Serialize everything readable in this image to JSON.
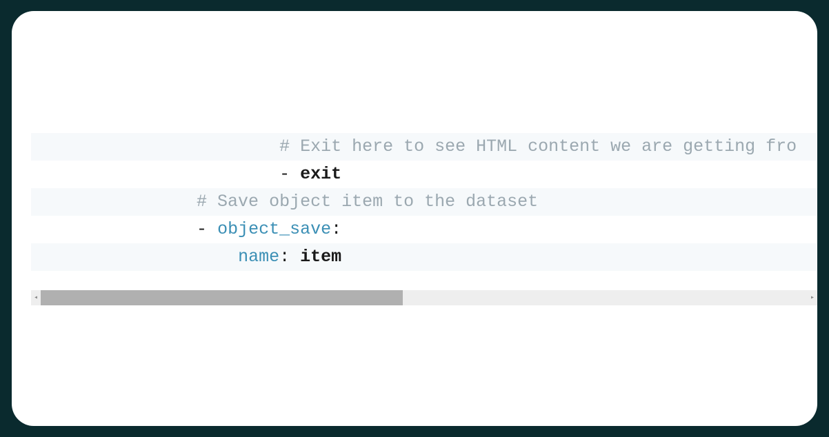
{
  "code": {
    "lines": [
      {
        "indent": "                        ",
        "segments": [
          {
            "type": "comment",
            "text": "# Exit here to see HTML content we are getting fro"
          }
        ],
        "striped": true
      },
      {
        "indent": "                        ",
        "segments": [
          {
            "type": "dash",
            "text": "- "
          },
          {
            "type": "keyword",
            "text": "exit"
          }
        ],
        "striped": false
      },
      {
        "indent": "                ",
        "segments": [
          {
            "type": "comment",
            "text": "# Save object item to the dataset"
          }
        ],
        "striped": true
      },
      {
        "indent": "                ",
        "segments": [
          {
            "type": "dash",
            "text": "- "
          },
          {
            "type": "key",
            "text": "object_save"
          },
          {
            "type": "colon",
            "text": ":"
          }
        ],
        "striped": false
      },
      {
        "indent": "                    ",
        "segments": [
          {
            "type": "key",
            "text": "name"
          },
          {
            "type": "colon",
            "text": ": "
          },
          {
            "type": "value",
            "text": "item"
          }
        ],
        "striped": true
      }
    ]
  },
  "scrollbar": {
    "leftArrow": "◂",
    "rightArrow": "▸"
  }
}
